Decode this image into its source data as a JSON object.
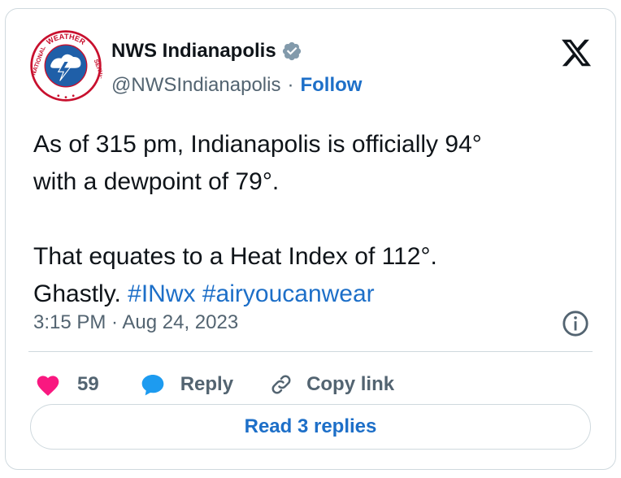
{
  "author": {
    "name": "NWS Indianapolis",
    "handle": "@NWSIndianapolis",
    "separator": "·",
    "follow_label": "Follow",
    "verified_icon": "verified-badge-icon",
    "logo_text_top": "WEATHER",
    "logo_text_left": "NATIONAL",
    "logo_text_right": "SERVICE"
  },
  "tweet": {
    "line1": "As of 315 pm, Indianapolis is officially 94°",
    "line2": "with a dewpoint of 79°.",
    "line3": "That equates to a Heat Index of 112°.",
    "line4_text": "Ghastly. ",
    "hashtag1": "#INwx",
    "hashtag2": "#airyoucanwear"
  },
  "timestamp": "3:15 PM · Aug 24, 2023",
  "actions": {
    "likes_count": "59",
    "reply_label": "Reply",
    "copy_label": "Copy link"
  },
  "read_replies_label": "Read 3 replies",
  "colors": {
    "link_blue": "#1d6fc8",
    "heart_pink": "#f91880",
    "reply_blue": "#1d9bf0",
    "muted": "#536471",
    "border": "#cfd9de"
  }
}
